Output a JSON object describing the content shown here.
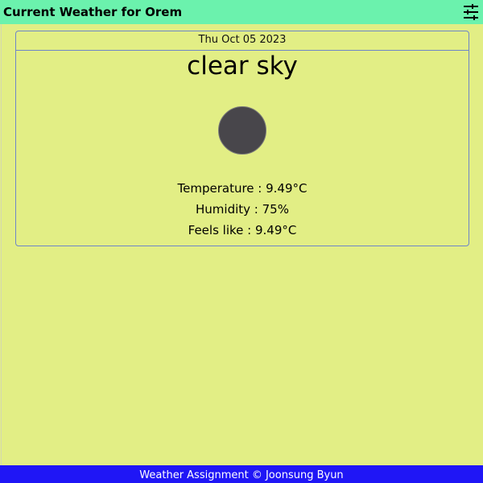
{
  "header": {
    "title": "Current Weather for Orem",
    "settings_icon": "sliders-icon"
  },
  "weather": {
    "date": "Thu Oct 05 2023",
    "description": "clear sky",
    "icon": "weather-condition-icon",
    "temperature": "Temperature : 9.49°C",
    "humidity": "Humidity : 75%",
    "feels_like": "Feels like : 9.49°C"
  },
  "footer": {
    "text": "Weather Assignment © Joonsung Byun"
  },
  "colors": {
    "header_bg": "#6bf2ad",
    "page_bg": "#e2ee85",
    "card_border": "#6e86c8",
    "footer_bg": "#1f16f6"
  }
}
